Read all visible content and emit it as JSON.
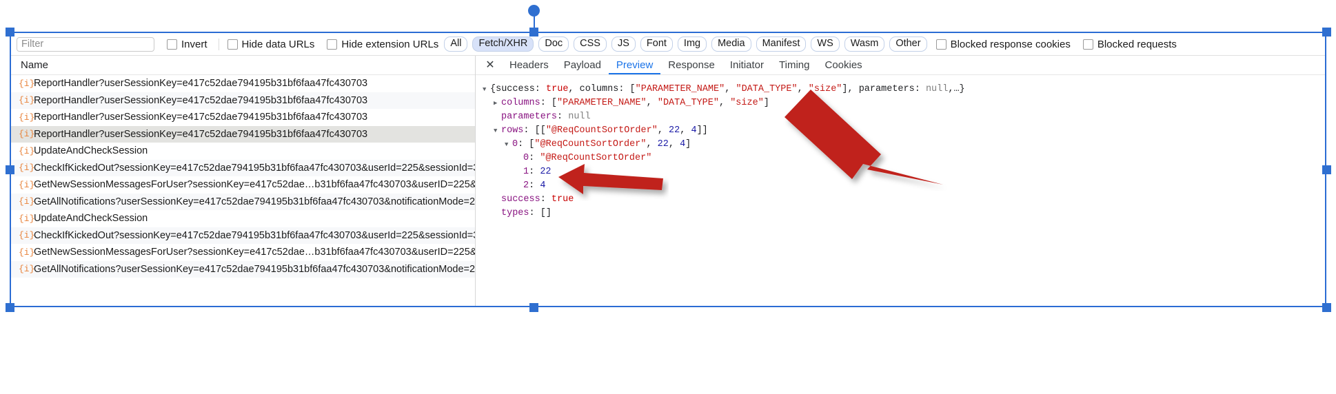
{
  "window": {
    "title": "Chrome DevTools Network panel"
  },
  "toolbar": {
    "filter_placeholder": "Filter",
    "filter_value": "",
    "checkboxes": [
      {
        "label": "Invert",
        "checked": false
      },
      {
        "label": "Hide data URLs",
        "checked": false
      },
      {
        "label": "Hide extension URLs",
        "checked": false
      }
    ],
    "type_filters": [
      {
        "label": "All",
        "active": false
      },
      {
        "label": "Fetch/XHR",
        "active": true
      },
      {
        "label": "Doc",
        "active": false
      },
      {
        "label": "CSS",
        "active": false
      },
      {
        "label": "JS",
        "active": false
      },
      {
        "label": "Font",
        "active": false
      },
      {
        "label": "Img",
        "active": false
      },
      {
        "label": "Media",
        "active": false
      },
      {
        "label": "Manifest",
        "active": false
      },
      {
        "label": "WS",
        "active": false
      },
      {
        "label": "Wasm",
        "active": false
      },
      {
        "label": "Other",
        "active": false
      }
    ],
    "trailing_checkboxes": [
      {
        "label": "Blocked response cookies",
        "checked": false
      },
      {
        "label": "Blocked requests",
        "checked": false
      }
    ]
  },
  "request_list": {
    "column_header": "Name",
    "icon": "xhr-braces-icon",
    "rows": [
      {
        "name": "ReportHandler?userSessionKey=e417c52dae794195b31bf6faa47fc430703",
        "selected": false
      },
      {
        "name": "ReportHandler?userSessionKey=e417c52dae794195b31bf6faa47fc430703",
        "selected": false
      },
      {
        "name": "ReportHandler?userSessionKey=e417c52dae794195b31bf6faa47fc430703",
        "selected": false
      },
      {
        "name": "ReportHandler?userSessionKey=e417c52dae794195b31bf6faa47fc430703",
        "selected": true
      },
      {
        "name": "UpdateAndCheckSession",
        "selected": false
      },
      {
        "name": "CheckIfKickedOut?sessionKey=e417c52dae794195b31bf6faa47fc430703&userId=225&sessionId=3…",
        "selected": false
      },
      {
        "name": "GetNewSessionMessagesForUser?sessionKey=e417c52dae…b31bf6faa47fc430703&userID=225&se…",
        "selected": false
      },
      {
        "name": "GetAllNotifications?userSessionKey=e417c52dae794195b31bf6faa47fc430703&notificationMode=2…",
        "selected": false
      },
      {
        "name": "UpdateAndCheckSession",
        "selected": false
      },
      {
        "name": "CheckIfKickedOut?sessionKey=e417c52dae794195b31bf6faa47fc430703&userId=225&sessionId=3…",
        "selected": false
      },
      {
        "name": "GetNewSessionMessagesForUser?sessionKey=e417c52dae…b31bf6faa47fc430703&userID=225&se…",
        "selected": false
      },
      {
        "name": "GetAllNotifications?userSessionKey=e417c52dae794195b31bf6faa47fc430703&notificationMode=2…",
        "selected": false
      }
    ]
  },
  "detail_pane": {
    "close_label": "✕",
    "tabs": [
      {
        "label": "Headers",
        "active": false
      },
      {
        "label": "Payload",
        "active": false
      },
      {
        "label": "Preview",
        "active": true
      },
      {
        "label": "Response",
        "active": false
      },
      {
        "label": "Initiator",
        "active": false
      },
      {
        "label": "Timing",
        "active": false
      },
      {
        "label": "Cookies",
        "active": false
      }
    ],
    "preview_tree": [
      {
        "indent": 0,
        "triangle": "down",
        "parts": [
          {
            "t": "{success: ",
            "c": "plain"
          },
          {
            "t": "true",
            "c": "bool"
          },
          {
            "t": ", columns: [",
            "c": "plain"
          },
          {
            "t": "\"PARAMETER_NAME\"",
            "c": "str"
          },
          {
            "t": ", ",
            "c": "plain"
          },
          {
            "t": "\"DATA_TYPE\"",
            "c": "str"
          },
          {
            "t": ", ",
            "c": "plain"
          },
          {
            "t": "\"size\"",
            "c": "str"
          },
          {
            "t": "], parameters: ",
            "c": "plain"
          },
          {
            "t": "null",
            "c": "null"
          },
          {
            "t": ",…}",
            "c": "plain"
          }
        ]
      },
      {
        "indent": 1,
        "triangle": "right",
        "parts": [
          {
            "t": "columns",
            "c": "prop"
          },
          {
            "t": ": [",
            "c": "plain"
          },
          {
            "t": "\"PARAMETER_NAME\"",
            "c": "str"
          },
          {
            "t": ", ",
            "c": "plain"
          },
          {
            "t": "\"DATA_TYPE\"",
            "c": "str"
          },
          {
            "t": ", ",
            "c": "plain"
          },
          {
            "t": "\"size\"",
            "c": "str"
          },
          {
            "t": "]",
            "c": "plain"
          }
        ]
      },
      {
        "indent": 1,
        "triangle": "none",
        "parts": [
          {
            "t": "parameters",
            "c": "prop"
          },
          {
            "t": ": ",
            "c": "plain"
          },
          {
            "t": "null",
            "c": "null"
          }
        ]
      },
      {
        "indent": 1,
        "triangle": "down",
        "parts": [
          {
            "t": "rows",
            "c": "prop"
          },
          {
            "t": ": [[",
            "c": "plain"
          },
          {
            "t": "\"@ReqCountSortOrder\"",
            "c": "str"
          },
          {
            "t": ", ",
            "c": "plain"
          },
          {
            "t": "22",
            "c": "num"
          },
          {
            "t": ", ",
            "c": "plain"
          },
          {
            "t": "4",
            "c": "num"
          },
          {
            "t": "]]",
            "c": "plain"
          }
        ]
      },
      {
        "indent": 2,
        "triangle": "down",
        "parts": [
          {
            "t": "0",
            "c": "idx"
          },
          {
            "t": ": [",
            "c": "plain"
          },
          {
            "t": "\"@ReqCountSortOrder\"",
            "c": "str"
          },
          {
            "t": ", ",
            "c": "plain"
          },
          {
            "t": "22",
            "c": "num"
          },
          {
            "t": ", ",
            "c": "plain"
          },
          {
            "t": "4",
            "c": "num"
          },
          {
            "t": "]",
            "c": "plain"
          }
        ]
      },
      {
        "indent": 3,
        "triangle": "none",
        "parts": [
          {
            "t": "0",
            "c": "idx"
          },
          {
            "t": ": ",
            "c": "plain"
          },
          {
            "t": "\"@ReqCountSortOrder\"",
            "c": "str"
          }
        ]
      },
      {
        "indent": 3,
        "triangle": "none",
        "parts": [
          {
            "t": "1",
            "c": "idx"
          },
          {
            "t": ": ",
            "c": "plain"
          },
          {
            "t": "22",
            "c": "num"
          }
        ]
      },
      {
        "indent": 3,
        "triangle": "none",
        "parts": [
          {
            "t": "2",
            "c": "idx"
          },
          {
            "t": ": ",
            "c": "plain"
          },
          {
            "t": "4",
            "c": "num"
          }
        ]
      },
      {
        "indent": 1,
        "triangle": "none",
        "parts": [
          {
            "t": "success",
            "c": "prop"
          },
          {
            "t": ": ",
            "c": "plain"
          },
          {
            "t": "true",
            "c": "bool"
          }
        ]
      },
      {
        "indent": 1,
        "triangle": "none",
        "parts": [
          {
            "t": "types",
            "c": "prop"
          },
          {
            "t": ": []",
            "c": "plain"
          }
        ]
      }
    ]
  },
  "annotations": {
    "arrow_color": "#c0241c",
    "selection_color": "#2f6fd0",
    "arrows": [
      {
        "name": "arrow-pointing-to-data-type"
      },
      {
        "name": "arrow-pointing-to-index-2-value"
      }
    ]
  }
}
